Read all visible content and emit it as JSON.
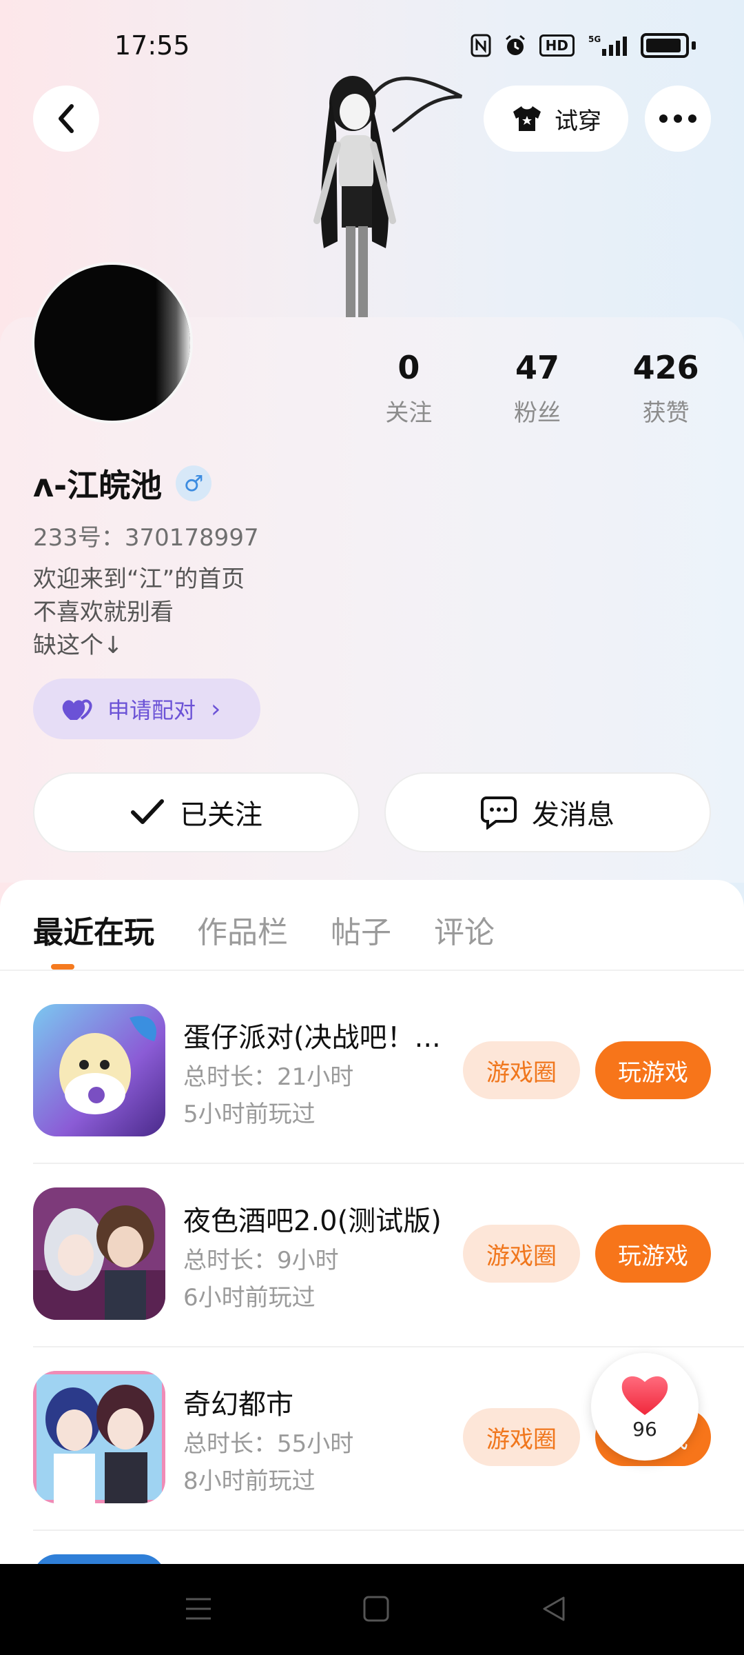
{
  "status_bar": {
    "time": "17:55",
    "icons": [
      "nfc-icon",
      "alarm-icon",
      "hd-icon",
      "5g-signal-icon",
      "battery-icon"
    ],
    "hd_label": "HD",
    "network_label": "5G"
  },
  "header": {
    "tryon_label": "试穿"
  },
  "profile": {
    "stats": [
      {
        "value": "0",
        "label": "关注"
      },
      {
        "value": "47",
        "label": "粉丝"
      },
      {
        "value": "426",
        "label": "获赞"
      }
    ],
    "name": "ʌ-江皖池",
    "gender_symbol": "♂",
    "uid": "233号：370178997",
    "bio": [
      "欢迎来到“江”的首页",
      "不喜欢就别看",
      "缺这个↓"
    ],
    "pair_label": "申请配对",
    "follow_label": "已关注",
    "message_label": "发消息"
  },
  "tabs": [
    {
      "label": "最近在玩",
      "active": true
    },
    {
      "label": "作品栏",
      "active": false
    },
    {
      "label": "帖子",
      "active": false
    },
    {
      "label": "评论",
      "active": false
    }
  ],
  "games": [
    {
      "title": "蛋仔派对(决战吧！...",
      "duration": "总时长：21小时",
      "last_played": "5小时前玩过",
      "circle_label": "游戏圈",
      "play_label": "玩游戏"
    },
    {
      "title": "夜色酒吧2.0(测试版)",
      "duration": "总时长：9小时",
      "last_played": "6小时前玩过",
      "circle_label": "游戏圈",
      "play_label": "玩游戏"
    },
    {
      "title": "奇幻都市",
      "duration": "总时长：55小时",
      "last_played": "8小时前玩过",
      "circle_label": "游戏圈",
      "play_label": "玩游戏"
    }
  ],
  "like_fab": {
    "count": "96"
  },
  "colors": {
    "accent": "#f7751a",
    "accent_light": "#fde6d8",
    "pair_purple": "#6b52d6",
    "pair_bg": "#e6ddf6"
  }
}
